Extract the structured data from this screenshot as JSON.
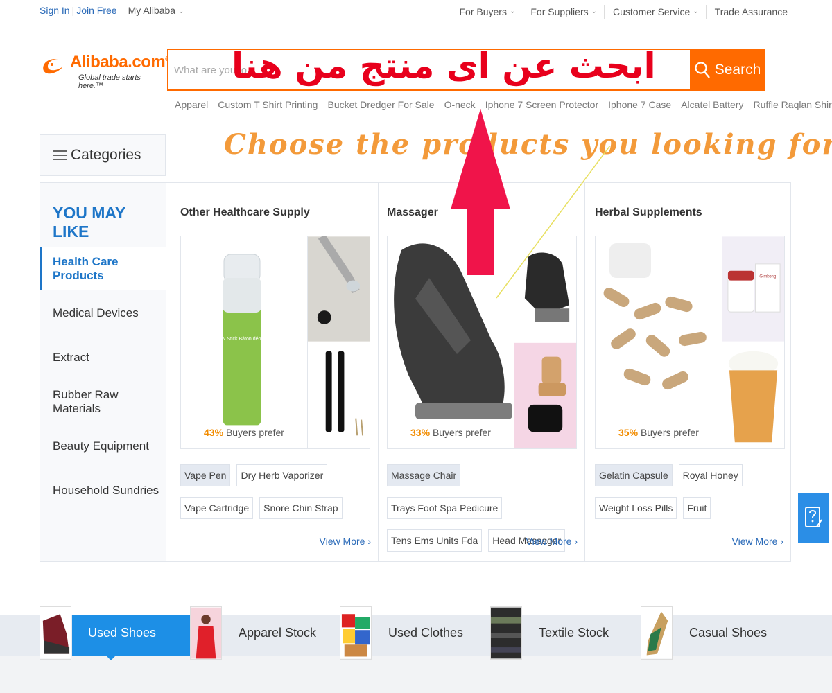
{
  "topbar": {
    "sign_in": "Sign In",
    "separator": "|",
    "join_free": "Join Free",
    "my_alibaba": "My Alibaba",
    "right_items": [
      "For Buyers",
      "For Suppliers",
      "Customer Service",
      "Trade Assurance"
    ]
  },
  "logo": {
    "brand": "Alibaba.com",
    "registered": "®",
    "tagline": "Global trade starts here.™"
  },
  "search": {
    "placeholder": "What are you lo",
    "button_label": "Search",
    "suggestions": [
      "Apparel",
      "Custom T Shirt Printing",
      "Bucket Dredger For Sale",
      "O-neck",
      "Iphone 7 Screen Protector",
      "Iphone 7 Case",
      "Alcatel Battery",
      "Ruffle Raqlan Shirt"
    ]
  },
  "overlays": {
    "arabic_text": "ابحث عن اى منتج من هنا",
    "english_text": "Choose the products you looking for !",
    "arrow_color": "#f0144a",
    "arabic_color": "#e8001c",
    "english_color": "#f39a3a"
  },
  "categories": {
    "label": "Categories",
    "icon": "list-icon"
  },
  "sidebar": {
    "heading": "YOU MAY LIKE",
    "items": [
      "Health Care Products",
      "Medical Devices",
      "Extract",
      "Rubber Raw Materials",
      "Beauty Equipment",
      "Household Sundries"
    ],
    "active_index": 0
  },
  "columns": [
    {
      "title": "Other Healthcare Supply",
      "prefer_pct": "43%",
      "prefer_text": "Buyers prefer",
      "tags": [
        "Vape Pen",
        "Dry Herb Vaporizer",
        "Vape Cartridge",
        "Snore Chin Strap"
      ],
      "view_more": "View More",
      "view_more_arrow": "›",
      "deodorant_label": "SIRUIN Stick Bâton déodorant"
    },
    {
      "title": "Massager",
      "prefer_pct": "33%",
      "prefer_text": "Buyers prefer",
      "tags": [
        "Massage Chair",
        "Trays Foot Spa Pedicure",
        "Tens Ems Units Fda",
        "Head Massager"
      ],
      "view_more": "View More",
      "view_more_arrow": "›"
    },
    {
      "title": "Herbal Supplements",
      "prefer_pct": "35%",
      "prefer_text": "Buyers prefer",
      "tags": [
        "Gelatin Capsule",
        "Royal Honey",
        "Weight Loss Pills",
        "Fruit"
      ],
      "view_more": "View More",
      "view_more_arrow": "›",
      "jar_label": "Gimkong"
    }
  ],
  "bottom_strip": {
    "items": [
      "Used Shoes",
      "Apparel Stock",
      "Used Clothes",
      "Textile Stock",
      "Casual Shoes"
    ],
    "active_index": 0
  },
  "colors": {
    "accent": "#ff6a00",
    "link": "#2a6ab8",
    "active_blue": "#1d8fe6"
  }
}
